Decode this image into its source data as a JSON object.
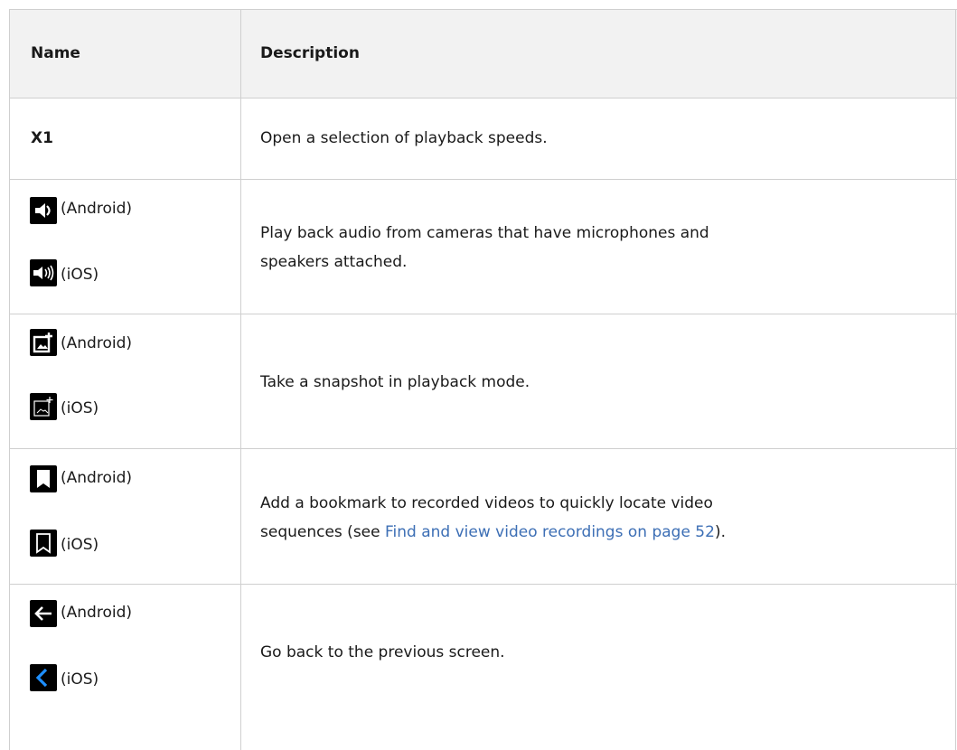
{
  "table": {
    "headers": {
      "name": "Name",
      "description": "Description"
    },
    "rows": [
      {
        "name": "X1",
        "description": "Open a selection of playback speeds."
      },
      {
        "android_icon": "speaker-icon",
        "ios_icon": "speaker-waves-icon",
        "android_label": "(Android)",
        "ios_label": "(iOS)",
        "description_line1": "Play back audio from cameras that have microphones and",
        "description_line2": "speakers attached."
      },
      {
        "android_icon": "snapshot-add-icon",
        "ios_icon": "snapshot-add-outline-icon",
        "android_label": "(Android)",
        "ios_label": "(iOS)",
        "description": "Take a snapshot in playback mode."
      },
      {
        "android_icon": "bookmark-icon",
        "ios_icon": "bookmark-outline-icon",
        "android_label": "(Android)",
        "ios_label": "(iOS)",
        "description_line1": "Add a bookmark to recorded videos to quickly locate video",
        "description_line2_pre": "sequences (see ",
        "description_line2_link": "Find and view video recordings on page 52",
        "description_line2_post": ")."
      },
      {
        "android_icon": "arrow-left-icon",
        "ios_icon": "chevron-left-icon",
        "android_label": "(Android)",
        "ios_label": "(iOS)",
        "description": "Go back to the previous screen."
      }
    ]
  },
  "colors": {
    "link": "#3d6fb5",
    "border": "#cfcfcf",
    "header_bg": "#f2f2f2",
    "ios_back_icon": "#1e8fff"
  }
}
